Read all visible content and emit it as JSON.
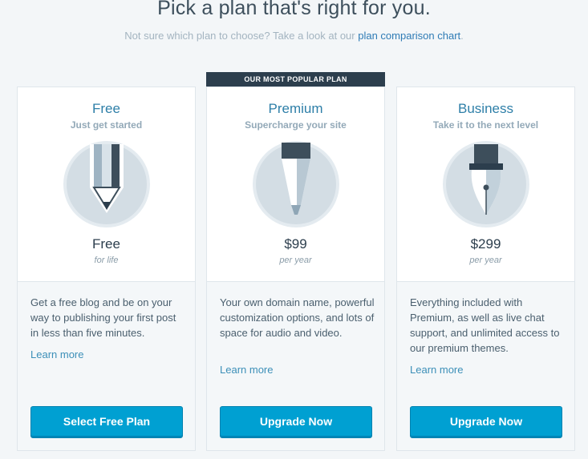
{
  "header": {
    "title": "Pick a plan that's right for you.",
    "subtitle_prefix": "Not sure which plan to choose? Take a look at our ",
    "subtitle_link": "plan comparison chart",
    "subtitle_suffix": "."
  },
  "popular_badge": "OUR MOST POPULAR PLAN",
  "plans": [
    {
      "name": "Free",
      "tagline": "Just get started",
      "price": "Free",
      "period": "for life",
      "description": "Get a free blog and be on your way to publishing your first post in less than five minutes.",
      "learn_more": "Learn more",
      "button": "Select Free Plan",
      "icon": "pencil-icon"
    },
    {
      "name": "Premium",
      "tagline": "Supercharge your site",
      "price": "$99",
      "period": "per year",
      "description": "Your own domain name, powerful customization options, and lots of space for audio and video.",
      "learn_more": "Learn more",
      "button": "Upgrade Now",
      "icon": "marker-icon"
    },
    {
      "name": "Business",
      "tagline": "Take it to the next level",
      "price": "$299",
      "period": "per year",
      "description": "Everything included with Premium, as well as live chat support, and unlimited access to our premium themes.",
      "learn_more": "Learn more",
      "button": "Upgrade Now",
      "icon": "fountain-pen-icon"
    }
  ],
  "colors": {
    "accent": "#00a0d2",
    "link": "#3c8fb8",
    "badge_bg": "#2c3e4d"
  }
}
